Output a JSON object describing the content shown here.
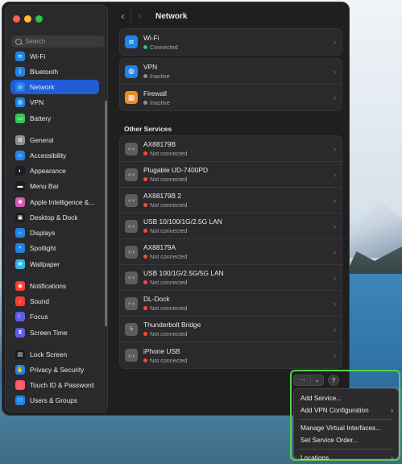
{
  "window": {
    "title": "Network"
  },
  "sidebar": {
    "search_placeholder": "Search",
    "items": [
      {
        "label": "Wi-Fi",
        "icon": "wifi-icon",
        "color": "#1e84e8",
        "glyph": "≋"
      },
      {
        "label": "Bluetooth",
        "icon": "bluetooth-icon",
        "color": "#1e84e8",
        "glyph": "ᛒ"
      },
      {
        "label": "Network",
        "icon": "network-icon",
        "color": "#1e84e8",
        "glyph": "◎",
        "active": true
      },
      {
        "label": "VPN",
        "icon": "vpn-icon",
        "color": "#1e84e8",
        "glyph": "◍"
      },
      {
        "label": "Battery",
        "icon": "battery-icon",
        "color": "#34c759",
        "glyph": "▭"
      },
      {
        "label": "General",
        "icon": "gear-icon",
        "color": "#8e8e93",
        "glyph": "⚙"
      },
      {
        "label": "Accessibility",
        "icon": "accessibility-icon",
        "color": "#1e84e8",
        "glyph": "☺"
      },
      {
        "label": "Appearance",
        "icon": "appearance-icon",
        "color": "#1c1c1e",
        "glyph": "◐"
      },
      {
        "label": "Menu Bar",
        "icon": "menu-bar-icon",
        "color": "#1c1c1e",
        "glyph": "▬"
      },
      {
        "label": "Apple Intelligence &...",
        "icon": "apple-intelligence-icon",
        "color": "#d45bb0",
        "glyph": "✺"
      },
      {
        "label": "Desktop & Dock",
        "icon": "desktop-dock-icon",
        "color": "#1c1c1e",
        "glyph": "▣"
      },
      {
        "label": "Displays",
        "icon": "displays-icon",
        "color": "#1e84e8",
        "glyph": "☼"
      },
      {
        "label": "Spotlight",
        "icon": "spotlight-icon",
        "color": "#1e84e8",
        "glyph": "⌕"
      },
      {
        "label": "Wallpaper",
        "icon": "wallpaper-icon",
        "color": "#2fb8e8",
        "glyph": "❋"
      },
      {
        "label": "Notifications",
        "icon": "notifications-icon",
        "color": "#ff3b30",
        "glyph": "◉"
      },
      {
        "label": "Sound",
        "icon": "sound-icon",
        "color": "#ff3b30",
        "glyph": "♪"
      },
      {
        "label": "Focus",
        "icon": "focus-icon",
        "color": "#5e5ce6",
        "glyph": "☾"
      },
      {
        "label": "Screen Time",
        "icon": "screen-time-icon",
        "color": "#5e5ce6",
        "glyph": "⧗"
      },
      {
        "label": "Lock Screen",
        "icon": "lock-screen-icon",
        "color": "#1c1c1e",
        "glyph": "▤"
      },
      {
        "label": "Privacy & Security",
        "icon": "privacy-icon",
        "color": "#1e84e8",
        "glyph": "✋"
      },
      {
        "label": "Touch ID & Password",
        "icon": "touch-id-icon",
        "color": "#ff5a6e",
        "glyph": "◌"
      },
      {
        "label": "Users & Groups",
        "icon": "users-groups-icon",
        "color": "#1e84e8",
        "glyph": "⚇"
      }
    ]
  },
  "main": {
    "top_services": [
      {
        "name": "Wi-Fi",
        "status": "Connected",
        "status_color": "green",
        "icon": "wifi-icon",
        "glyph": "≋",
        "tone": "blue"
      },
      {
        "name": "VPN",
        "status": "Inactive",
        "status_color": "grey",
        "icon": "vpn-icon",
        "glyph": "◍",
        "tone": "blue"
      },
      {
        "name": "Firewall",
        "status": "Inactive",
        "status_color": "grey",
        "icon": "firewall-icon",
        "glyph": "▦",
        "tone": "orange"
      }
    ],
    "other_services_title": "Other Services",
    "other_services": [
      {
        "name": "AX88179B",
        "status": "Not connected"
      },
      {
        "name": "Plugable UD-7400PD",
        "status": "Not connected"
      },
      {
        "name": "AX88179B 2",
        "status": "Not connected"
      },
      {
        "name": "USB 10/100/1G/2.5G LAN",
        "status": "Not connected"
      },
      {
        "name": "AX88179A",
        "status": "Not connected"
      },
      {
        "name": "USB 100/1G/2.5G/5G LAN",
        "status": "Not connected"
      },
      {
        "name": "DL-Dock",
        "status": "Not connected"
      },
      {
        "name": "Thunderbolt Bridge",
        "status": "Not connected",
        "thunder": true
      },
      {
        "name": "iPhone USB",
        "status": "Not connected"
      }
    ]
  },
  "controls": {
    "more_label": "···",
    "dropdown_label": "⌄",
    "help_label": "?"
  },
  "menu": {
    "items": [
      {
        "label": "Add Service...",
        "submenu": false
      },
      {
        "label": "Add VPN Configuration",
        "submenu": true
      },
      {
        "separator": true
      },
      {
        "label": "Manage Virtual Interfaces...",
        "submenu": false
      },
      {
        "label": "Set Service Order...",
        "submenu": false
      },
      {
        "separator": true
      },
      {
        "label": "Locations",
        "submenu": true
      }
    ]
  },
  "colors": {
    "accent": "#1f5cd6",
    "connected": "#34c759",
    "not_connected": "#ff453a",
    "highlight_frame": "#55d14d"
  }
}
